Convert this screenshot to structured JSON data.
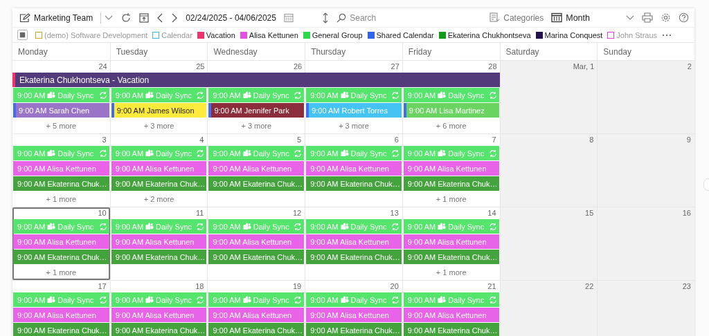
{
  "toolbar": {
    "team": "Marketing Team",
    "date_range": "02/24/2025 - 04/06/2025",
    "search": {
      "placeholder": "Search"
    },
    "categories": "Categories",
    "view": "Month"
  },
  "legend": [
    {
      "label": "(demo) Software Development",
      "color": "#c9a227",
      "checked": false
    },
    {
      "label": "Calendar",
      "color": "#3bb3f0",
      "checked": false
    },
    {
      "label": "Vacation",
      "color": "#f0336e",
      "checked": true
    },
    {
      "label": "Alisa Kettunen",
      "color": "#e450e4",
      "checked": true
    },
    {
      "label": "General Group",
      "color": "#2fd84a",
      "checked": true
    },
    {
      "label": "Shared Calendar",
      "color": "#2f62f0",
      "checked": true
    },
    {
      "label": "Ekaterina Chukhontseva",
      "color": "#139a16",
      "checked": true
    },
    {
      "label": "Marina Conquest",
      "color": "#23114d",
      "checked": true
    },
    {
      "label": "John Straus",
      "color": "#e83ae8",
      "checked": false
    }
  ],
  "weekdays": [
    "Monday",
    "Tuesday",
    "Wednesday",
    "Thursday",
    "Friday",
    "Saturday",
    "Sunday"
  ],
  "weeks": [
    {
      "all_day": {
        "title": "Ekaterina Chukhontseva - Vacation",
        "color": "#533a7a",
        "stripe": {
          "color": "#f0336e"
        }
      },
      "days": [
        {
          "date": "24",
          "weekend": false,
          "selected": false,
          "events": [
            {
              "kind": "sync",
              "time": "9:00 AM",
              "title": "Daily Sync",
              "color": "#55e46c"
            },
            {
              "kind": "accent",
              "time": "9:00 AM",
              "title": "Sarah Chen",
              "color": "#9a74c6",
              "stripe": {
                "color": "#3f6df2"
              }
            }
          ],
          "more": "+ 5 more"
        },
        {
          "date": "25",
          "weekend": false,
          "selected": false,
          "events": [
            {
              "kind": "sync",
              "time": "9:00 AM",
              "title": "Daily Sync",
              "color": "#55e46c"
            },
            {
              "kind": "accent",
              "time": "9:00 AM",
              "title": "James Wilson",
              "color": "#ffeb3b",
              "stripe": {
                "color": "#3f6df2"
              }
            }
          ],
          "more": "+ 3 more"
        },
        {
          "date": "26",
          "weekend": false,
          "selected": false,
          "events": [
            {
              "kind": "sync",
              "time": "9:00 AM",
              "title": "Daily Sync",
              "color": "#55e46c"
            },
            {
              "kind": "accent",
              "time": "9:00 AM",
              "title": "Jennifer Park",
              "color": "#8b2d3a",
              "stripe": {
                "color": "#3f6df2"
              }
            }
          ],
          "more": "+ 3 more"
        },
        {
          "date": "27",
          "weekend": false,
          "selected": false,
          "events": [
            {
              "kind": "sync",
              "time": "9:00 AM",
              "title": "Daily Sync",
              "color": "#55e46c"
            },
            {
              "kind": "accent",
              "time": "9:00 AM",
              "title": "Robert Torres",
              "color": "#45c3f5",
              "stripe": {
                "color": "#3f6df2"
              }
            }
          ],
          "more": "+ 3 more"
        },
        {
          "date": "28",
          "weekend": false,
          "selected": false,
          "events": [
            {
              "kind": "sync",
              "time": "9:00 AM",
              "title": "Daily Sync",
              "color": "#55e46c"
            },
            {
              "kind": "accent",
              "time": "9:00 AM",
              "title": "Lisa Martinez",
              "color": "#69d45f",
              "stripe": {
                "color": "#3f6df2"
              }
            }
          ],
          "more": "+ 6 more"
        },
        {
          "date": "Mar, 1",
          "weekend": true,
          "selected": false
        },
        {
          "date": "2",
          "weekend": true,
          "selected": false
        }
      ]
    },
    {
      "days": [
        {
          "date": "3",
          "weekend": false,
          "selected": false,
          "events": [
            {
              "kind": "sync",
              "time": "9:00 AM",
              "title": "Daily Sync",
              "color": "#55e46c"
            },
            {
              "kind": "plain",
              "time": "9:00 AM",
              "title": "Alisa Kettunen",
              "color": "#e863e8"
            },
            {
              "kind": "plain",
              "time": "9:00 AM",
              "title": "Ekaterina Chuk…",
              "color": "#45a33d"
            }
          ],
          "more": "+ 1 more"
        },
        {
          "date": "4",
          "weekend": false,
          "selected": false,
          "events": [
            {
              "kind": "sync",
              "time": "9:00 AM",
              "title": "Daily Sync",
              "color": "#55e46c"
            },
            {
              "kind": "plain",
              "time": "9:00 AM",
              "title": "Alisa Kettunen",
              "color": "#e863e8"
            },
            {
              "kind": "plain",
              "time": "9:00 AM",
              "title": "Ekaterina Chuk…",
              "color": "#45a33d"
            }
          ],
          "more": "+ 2 more"
        },
        {
          "date": "5",
          "weekend": false,
          "selected": false,
          "events": [
            {
              "kind": "sync",
              "time": "9:00 AM",
              "title": "Daily Sync",
              "color": "#55e46c"
            },
            {
              "kind": "plain",
              "time": "9:00 AM",
              "title": "Alisa Kettunen",
              "color": "#e863e8"
            },
            {
              "kind": "plain",
              "time": "9:00 AM",
              "title": "Ekaterina Chuk…",
              "color": "#45a33d"
            }
          ]
        },
        {
          "date": "6",
          "weekend": false,
          "selected": false,
          "events": [
            {
              "kind": "sync",
              "time": "9:00 AM",
              "title": "Daily Sync",
              "color": "#55e46c"
            },
            {
              "kind": "plain",
              "time": "9:00 AM",
              "title": "Alisa Kettunen",
              "color": "#e863e8"
            },
            {
              "kind": "plain",
              "time": "9:00 AM",
              "title": "Ekaterina Chuk…",
              "color": "#45a33d"
            }
          ]
        },
        {
          "date": "7",
          "weekend": false,
          "selected": false,
          "events": [
            {
              "kind": "sync",
              "time": "9:00 AM",
              "title": "Daily Sync",
              "color": "#55e46c"
            },
            {
              "kind": "plain",
              "time": "9:00 AM",
              "title": "Alisa Kettunen",
              "color": "#e863e8"
            },
            {
              "kind": "plain",
              "time": "9:00 AM",
              "title": "Ekaterina Chuk…",
              "color": "#45a33d"
            }
          ],
          "more": "+ 1 more"
        },
        {
          "date": "8",
          "weekend": true,
          "selected": false
        },
        {
          "date": "9",
          "weekend": true,
          "selected": false
        }
      ]
    },
    {
      "days": [
        {
          "date": "10",
          "weekend": false,
          "selected": true,
          "events": [
            {
              "kind": "sync",
              "time": "9:00 AM",
              "title": "Daily Sync",
              "color": "#55e46c"
            },
            {
              "kind": "plain",
              "time": "9:00 AM",
              "title": "Alisa Kettunen",
              "color": "#e863e8"
            },
            {
              "kind": "plain",
              "time": "9:00 AM",
              "title": "Ekaterina Chuk…",
              "color": "#45a33d"
            }
          ],
          "more": "+ 1 more"
        },
        {
          "date": "11",
          "weekend": false,
          "selected": false,
          "events": [
            {
              "kind": "sync",
              "time": "9:00 AM",
              "title": "Daily Sync",
              "color": "#55e46c"
            },
            {
              "kind": "plain",
              "time": "9:00 AM",
              "title": "Alisa Kettunen",
              "color": "#e863e8"
            },
            {
              "kind": "plain",
              "time": "9:00 AM",
              "title": "Ekaterina Chuk…",
              "color": "#45a33d"
            }
          ]
        },
        {
          "date": "12",
          "weekend": false,
          "selected": false,
          "events": [
            {
              "kind": "sync",
              "time": "9:00 AM",
              "title": "Daily Sync",
              "color": "#55e46c"
            },
            {
              "kind": "plain",
              "time": "9:00 AM",
              "title": "Alisa Kettunen",
              "color": "#e863e8"
            },
            {
              "kind": "plain",
              "time": "9:00 AM",
              "title": "Ekaterina Chuk…",
              "color": "#45a33d"
            }
          ]
        },
        {
          "date": "13",
          "weekend": false,
          "selected": false,
          "events": [
            {
              "kind": "sync",
              "time": "9:00 AM",
              "title": "Daily Sync",
              "color": "#55e46c"
            },
            {
              "kind": "plain",
              "time": "9:00 AM",
              "title": "Alisa Kettunen",
              "color": "#e863e8"
            },
            {
              "kind": "plain",
              "time": "9:00 AM",
              "title": "Ekaterina Chuk…",
              "color": "#45a33d"
            }
          ]
        },
        {
          "date": "14",
          "weekend": false,
          "selected": false,
          "events": [
            {
              "kind": "sync",
              "time": "9:00 AM",
              "title": "Daily Sync",
              "color": "#55e46c"
            },
            {
              "kind": "plain",
              "time": "9:00 AM",
              "title": "Alisa Kettunen",
              "color": "#e863e8"
            },
            {
              "kind": "plain",
              "time": "9:00 AM",
              "title": "Ekaterina Chuk…",
              "color": "#45a33d"
            }
          ],
          "more": "+ 1 more"
        },
        {
          "date": "15",
          "weekend": true,
          "selected": false
        },
        {
          "date": "16",
          "weekend": true,
          "selected": false
        }
      ]
    },
    {
      "days": [
        {
          "date": "17",
          "weekend": false,
          "selected": false,
          "events": [
            {
              "kind": "sync",
              "time": "9:00 AM",
              "title": "Daily Sync",
              "color": "#55e46c"
            },
            {
              "kind": "plain",
              "time": "9:00 AM",
              "title": "Alisa Kettunen",
              "color": "#e863e8"
            },
            {
              "kind": "plain",
              "time": "9:00 AM",
              "title": "Ekaterina Chuk…",
              "color": "#45a33d"
            }
          ]
        },
        {
          "date": "18",
          "weekend": false,
          "selected": false,
          "events": [
            {
              "kind": "sync",
              "time": "9:00 AM",
              "title": "Daily Sync",
              "color": "#55e46c"
            },
            {
              "kind": "plain",
              "time": "9:00 AM",
              "title": "Alisa Kettunen",
              "color": "#e863e8"
            },
            {
              "kind": "plain",
              "time": "9:00 AM",
              "title": "Ekaterina Chuk…",
              "color": "#45a33d"
            }
          ]
        },
        {
          "date": "19",
          "weekend": false,
          "selected": false,
          "events": [
            {
              "kind": "sync",
              "time": "9:00 AM",
              "title": "Daily Sync",
              "color": "#55e46c"
            },
            {
              "kind": "plain",
              "time": "9:00 AM",
              "title": "Alisa Kettunen",
              "color": "#e863e8"
            },
            {
              "kind": "plain",
              "time": "9:00 AM",
              "title": "Ekaterina Chuk…",
              "color": "#45a33d"
            }
          ]
        },
        {
          "date": "20",
          "weekend": false,
          "selected": false,
          "events": [
            {
              "kind": "sync",
              "time": "9:00 AM",
              "title": "Daily Sync",
              "color": "#55e46c"
            },
            {
              "kind": "plain",
              "time": "9:00 AM",
              "title": "Alisa Kettunen",
              "color": "#e863e8"
            },
            {
              "kind": "plain",
              "time": "9:00 AM",
              "title": "Ekaterina Chuk…",
              "color": "#45a33d"
            }
          ]
        },
        {
          "date": "21",
          "weekend": false,
          "selected": false,
          "events": [
            {
              "kind": "sync",
              "time": "9:00 AM",
              "title": "Daily Sync",
              "color": "#55e46c"
            },
            {
              "kind": "plain",
              "time": "9:00 AM",
              "title": "Alisa Kettunen",
              "color": "#e863e8"
            },
            {
              "kind": "plain",
              "time": "9:00 AM",
              "title": "Ekaterina Chuk…",
              "color": "#45a33d"
            }
          ]
        },
        {
          "date": "22",
          "weekend": true,
          "selected": false
        },
        {
          "date": "23",
          "weekend": true,
          "selected": false
        }
      ]
    }
  ]
}
